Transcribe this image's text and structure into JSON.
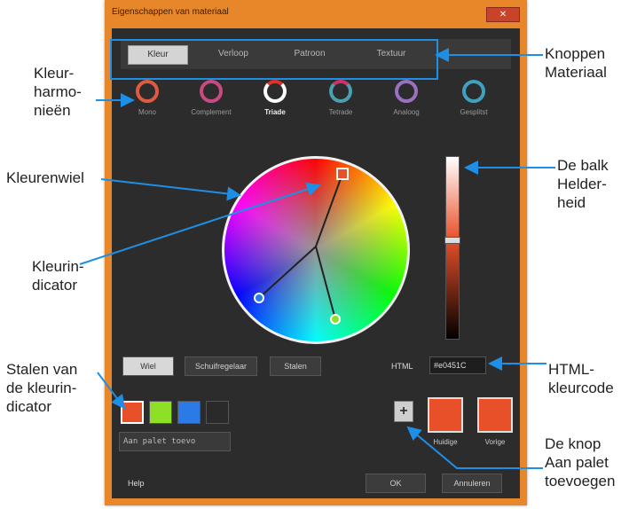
{
  "window": {
    "title": "Eigenschappen van materiaal",
    "close_label": "✕",
    "accent_color": "#e8862a"
  },
  "tabs": [
    "Kleur",
    "Verloop",
    "Patroon",
    "Textuur"
  ],
  "harmonies": [
    {
      "label": "Mono",
      "color": "#e05a40"
    },
    {
      "label": "Complement",
      "color": "#c84a80"
    },
    {
      "label": "Triade",
      "color": "#ffffff"
    },
    {
      "label": "Tetrade",
      "color": "#d0306a"
    },
    {
      "label": "Analoog",
      "color": "#9a70c0"
    },
    {
      "label": "Gesplitst",
      "color": "#40a0c0"
    }
  ],
  "modes": [
    "Wiel",
    "Schuifregelaar",
    "Stalen"
  ],
  "hex": {
    "label": "HTML",
    "value": "#e0451C"
  },
  "swatches": [
    "#e8502a",
    "#8ee027",
    "#2a7ae8",
    "#2a2a2a"
  ],
  "add_palette_label": "Aan palet toevo",
  "add_button_label": "+",
  "compare": [
    {
      "label": "Huidige",
      "color": "#e8502a"
    },
    {
      "label": "Vorige",
      "color": "#e8502a"
    }
  ],
  "footer": {
    "help": "Help",
    "ok": "OK",
    "cancel": "Annuleren"
  },
  "brightness_level": 0.45,
  "annotations": {
    "harmonies": [
      "Kleur-",
      "harmo-",
      "nieën"
    ],
    "wheel": [
      "Kleurenwiel"
    ],
    "indicator": [
      "Kleurin-",
      "dicator"
    ],
    "swatches": [
      "Stalen van",
      "de kleurin-",
      "dicator"
    ],
    "buttons": [
      "Knoppen",
      "Materiaal"
    ],
    "brightness": [
      "De balk",
      "Helder-",
      "heid"
    ],
    "hexcode": [
      "HTML-",
      "kleurcode"
    ],
    "addbutton": [
      "De knop",
      "Aan palet",
      "toevoegen"
    ]
  },
  "annotation_color": "#1e8fe6"
}
